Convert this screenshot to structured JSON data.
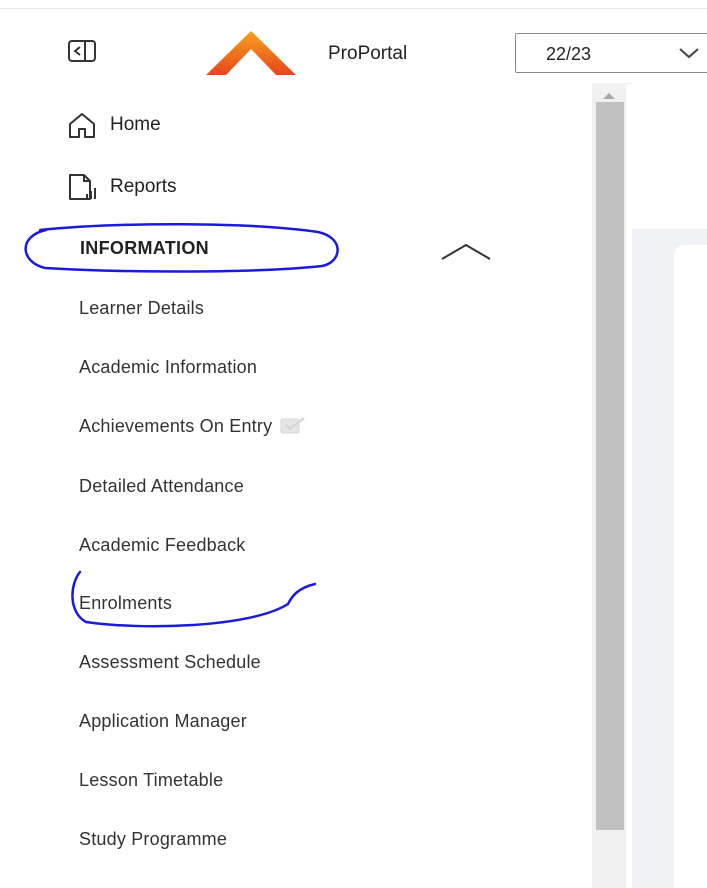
{
  "header": {
    "brand": "ProPortal",
    "year_value": "22/23"
  },
  "sidebar": {
    "items": [
      {
        "label": "Home",
        "icon": "home-icon"
      },
      {
        "label": "Reports",
        "icon": "reports-icon"
      }
    ],
    "section": {
      "title": "INFORMATION",
      "expanded": true,
      "items": [
        {
          "label": "Learner Details"
        },
        {
          "label": "Academic Information"
        },
        {
          "label": "Achievements On Entry",
          "icon": "checkbox-icon"
        },
        {
          "label": "Detailed Attendance"
        },
        {
          "label": "Academic Feedback"
        },
        {
          "label": "Enrolments"
        },
        {
          "label": "Assessment Schedule"
        },
        {
          "label": "Application Manager"
        },
        {
          "label": "Lesson Timetable"
        },
        {
          "label": "Study Programme"
        }
      ]
    }
  },
  "colors": {
    "logo_gradient_top": "#f7a21b",
    "logo_gradient_bottom": "#e8451e",
    "annotation": "#1a1adb",
    "scroll_thumb": "#c1c1c1",
    "content_background": "#f0f2f5"
  }
}
